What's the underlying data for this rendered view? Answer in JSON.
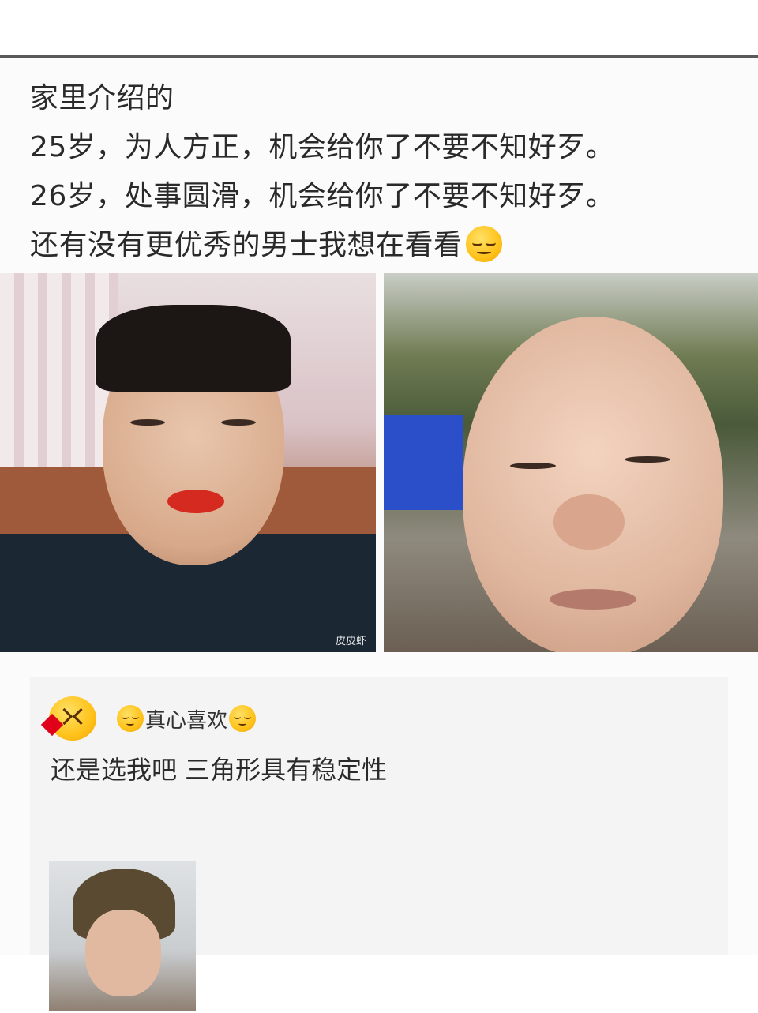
{
  "post": {
    "lines": [
      "家里介绍的",
      "25岁，为人方正，机会给你了不要不知好歹。",
      "26岁，处事圆滑，机会给你了不要不知好歹。",
      "还有没有更优秀的男士我想在看看"
    ],
    "end_emoji": "smirk-emoji"
  },
  "photos": [
    {
      "subject": "man with red lipstick indoors",
      "watermark": "皮皮虾"
    },
    {
      "subject": "man with round face outdoors"
    }
  ],
  "comment": {
    "avatar": "kiss-heart-emoji",
    "username": "真心喜欢",
    "text": "还是选我吧 三角形具有稳定性",
    "image": "young man with bowl haircut"
  },
  "colors": {
    "text": "#2a2a2a",
    "top_rule": "#5a5a5a",
    "comment_bg": "#f4f4f4",
    "lipstick": "#d42a1f"
  }
}
